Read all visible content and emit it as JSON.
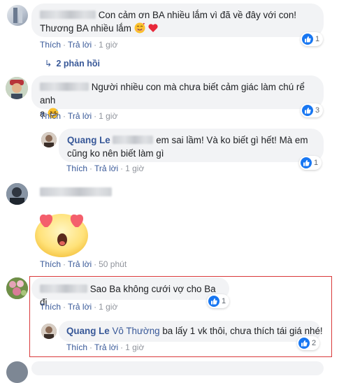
{
  "actions": {
    "like": "Thích",
    "reply": "Trả lời",
    "sep": "·"
  },
  "comments": [
    {
      "text": "Con cảm ơn BA nhiều lắm vì đã về đây với con!",
      "text2": "Thương BA nhiều lắm",
      "time": "1 giờ",
      "likes": "1",
      "replies_label": "2 phản hồi"
    },
    {
      "text": "Người nhiều con mà chưa biết cảm giác làm chú rể anh",
      "text2": "ạ",
      "time": "1 giờ",
      "likes": "3"
    },
    {
      "author": "Quang Le",
      "text": "em sai lầm! Và ko biết gì hết! Mà em",
      "text2": "cũng ko nên biết làm gì",
      "time": "1 giờ",
      "likes": "1"
    },
    {
      "time": "50 phút"
    },
    {
      "text": "Sao Ba không cưới vợ cho Ba đi",
      "time": "1 giờ",
      "likes": "1"
    },
    {
      "author": "Quang Le",
      "tag": "Vô Thường",
      "text": "ba lấy 1 vk thôi, chưa thích tái giá nhé!",
      "time": "1 giờ",
      "likes": "2"
    }
  ],
  "colors": {
    "link": "#385898",
    "like_blue": "#1877f2",
    "highlight_border": "#d9393a",
    "bubble": "#f2f3f5"
  }
}
